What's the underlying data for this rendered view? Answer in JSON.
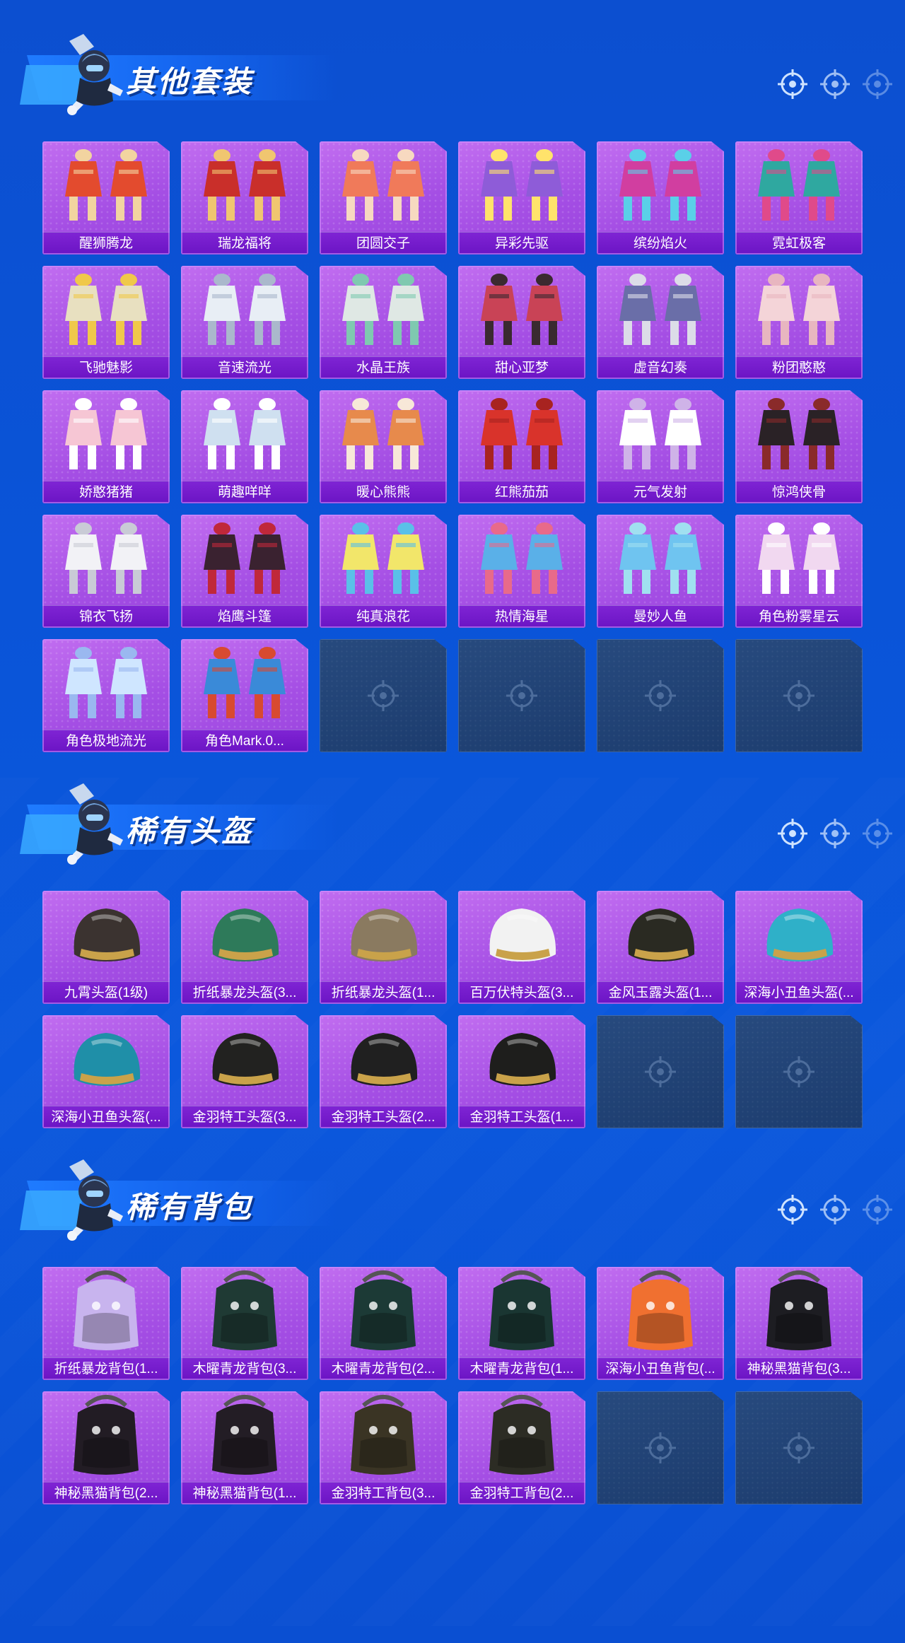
{
  "colors": {
    "background": "#0a54d8",
    "tile_purple": "#a44ee4",
    "label_purple": "#7f24d4",
    "empty_tile": "#23457a"
  },
  "sections": [
    {
      "title": "其他套装",
      "items": [
        "醒狮腾龙",
        "瑞龙福将",
        "团圆交子",
        "异彩先驱",
        "缤纷焰火",
        "霓虹极客",
        "飞驰魅影",
        "音速流光",
        "水晶王族",
        "甜心亚梦",
        "虚音幻奏",
        "粉团憨憨",
        "娇憨猪猪",
        "萌趣咩咩",
        "暖心熊熊",
        "红熊茄茄",
        "元气发射",
        "惊鸿侠骨",
        "锦衣飞扬",
        "焰鹰斗篷",
        "纯真浪花",
        "热情海星",
        "曼妙人鱼",
        "角色粉雾星云",
        "角色极地流光",
        "角色Mark.0..."
      ],
      "empty_slots": 4
    },
    {
      "title": "稀有头盔",
      "items": [
        "九霄头盔(1级)",
        "折纸暴龙头盔(3...",
        "折纸暴龙头盔(1...",
        "百万伏特头盔(3...",
        "金风玉露头盔(1...",
        "深海小丑鱼头盔(...",
        "深海小丑鱼头盔(...",
        "金羽特工头盔(3...",
        "金羽特工头盔(2...",
        "金羽特工头盔(1..."
      ],
      "empty_slots": 2
    },
    {
      "title": "稀有背包",
      "items": [
        "折纸暴龙背包(1...",
        "木曜青龙背包(3...",
        "木曜青龙背包(2...",
        "木曜青龙背包(1...",
        "深海小丑鱼背包(...",
        "神秘黑猫背包(3...",
        "神秘黑猫背包(2...",
        "神秘黑猫背包(1...",
        "金羽特工背包(3...",
        "金羽特工背包(2..."
      ],
      "empty_slots": 2
    }
  ]
}
